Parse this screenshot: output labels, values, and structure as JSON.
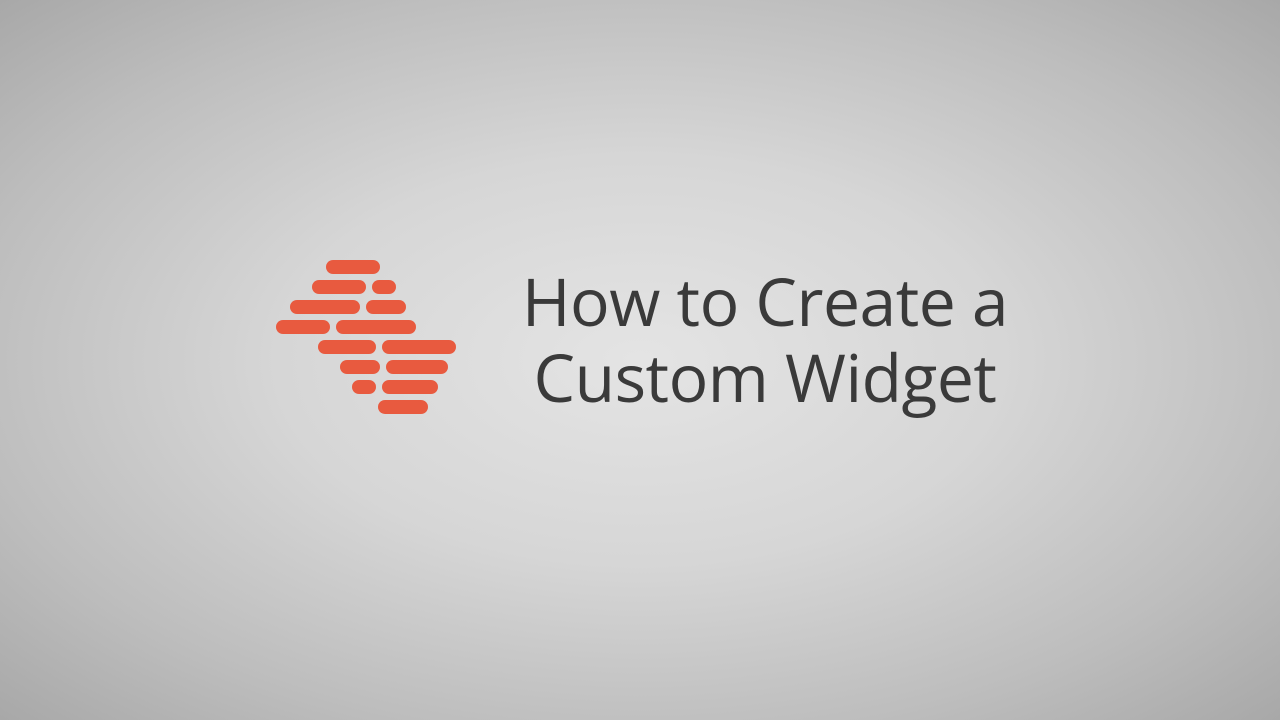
{
  "title_line1": "How to Create a",
  "title_line2": "Custom Widget",
  "colors": {
    "accent": "#e85a3f",
    "text": "#3a3a3a"
  }
}
